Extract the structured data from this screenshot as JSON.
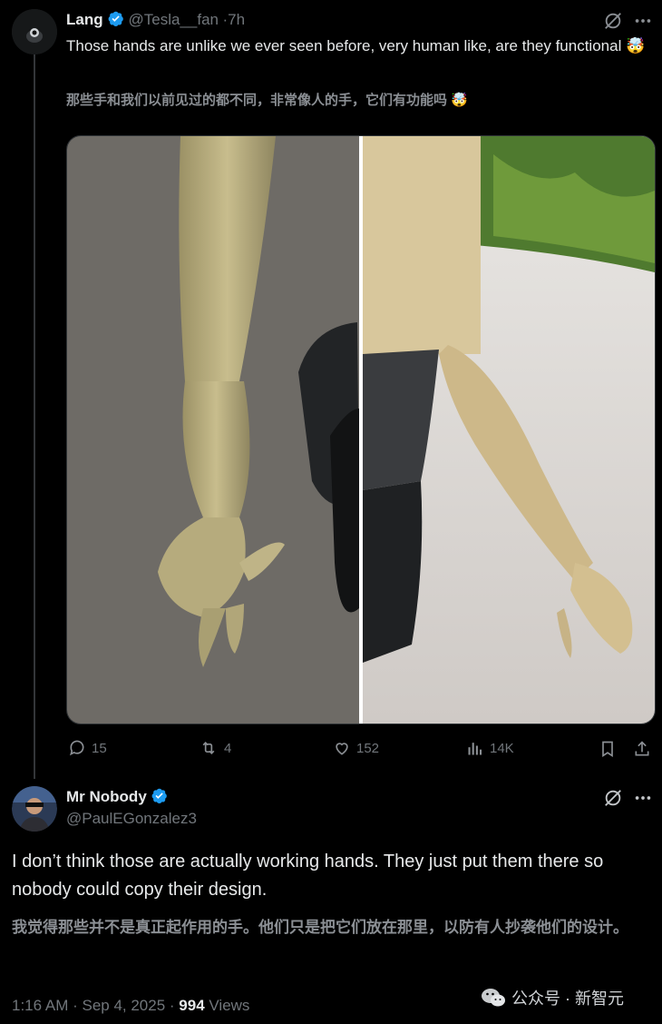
{
  "tweet1": {
    "name": "Lang",
    "handle": "@Tesla__fan",
    "time": "7h",
    "text": "Those hands are unlike we ever seen before, very human like, are they functional 🤯",
    "translation": "那些手和我们以前见过的都不同，非常像人的手，它们有功能吗 🤯",
    "actions": {
      "replies": "15",
      "reposts": "4",
      "likes": "152",
      "views": "14K"
    }
  },
  "tweet2": {
    "name": "Mr Nobody",
    "handle": "@PaulEGonzalez3",
    "text": "I don’t think those are actually working hands. They just put them there so nobody could copy their design.",
    "translation": "我觉得那些并不是真正起作用的手。他们只是把它们放在那里，以防有人抄袭他们的设计。",
    "time": "1:16 AM · Sep 4, 2025 · ",
    "views_count": "994",
    "views_label": " Views"
  },
  "watermark": "公众号 · 新智元",
  "colors": {
    "background": "#000000",
    "text": "#e7e9ea",
    "muted": "#71767b",
    "verified": "#1d9bf0"
  }
}
